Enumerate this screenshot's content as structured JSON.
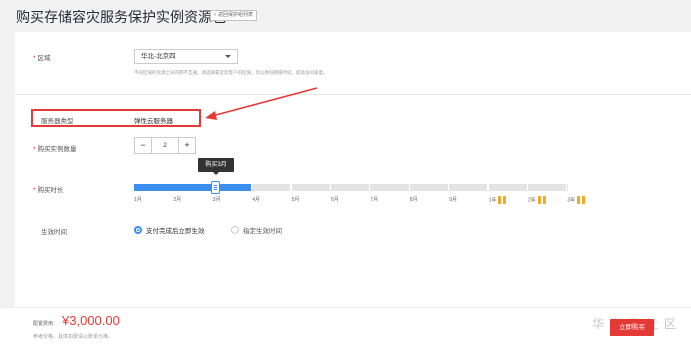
{
  "header": {
    "title": "购买存储容灾服务保护实例资源包",
    "back_label": "返回保护组列表"
  },
  "region": {
    "label": "区域",
    "value": "华北-北京四",
    "hint": "不同区域的资源之间内网不互通。请选择靠近您客户的区域，可以降低网络时延、提高访问速度。"
  },
  "server_type": {
    "label": "服务器类型",
    "value": "弹性云服务器"
  },
  "quantity": {
    "label": "购买实例数量",
    "minus": "−",
    "value": "2",
    "plus": "+"
  },
  "duration": {
    "label": "购买时长",
    "tooltip": "购买3月",
    "selected_months": 3,
    "ticks": [
      "1月",
      "2月",
      "3月",
      "4月",
      "5月",
      "6月",
      "7月",
      "8月",
      "9月",
      "1年",
      "2年",
      "3年"
    ]
  },
  "effective": {
    "label": "生效时间",
    "option_1": "支付完成后立即生效",
    "option_2": "指定生效时间",
    "selected": "option_1"
  },
  "footer": {
    "fee_label": "配置费用",
    "fee_value": "¥3,000.00",
    "fee_note": "参考价格，具体扣费请以账单为准。",
    "buy_label": "立即购买",
    "watermark": "华为云社区"
  },
  "colors": {
    "accent": "#3b8ff0",
    "danger": "#e53935",
    "gift": "#f5a623"
  }
}
